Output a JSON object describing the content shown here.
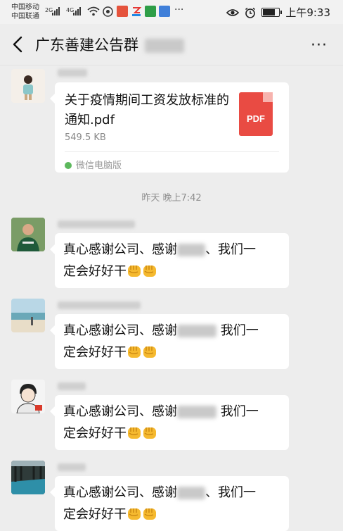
{
  "status_bar": {
    "carrier_1": "中国移动",
    "carrier_2": "中国联通",
    "net_1": "2G",
    "net_2": "4G",
    "dots": "···",
    "time": "上午9:33"
  },
  "nav": {
    "title": "广东善建公告群"
  },
  "file_message": {
    "file_name": "关于疫情期间工资发放标准的通知.pdf",
    "file_size": "549.5 KB",
    "icon_label": "PDF",
    "source": "微信电脑版"
  },
  "time_separator": "昨天 晚上7:42",
  "messages": [
    {
      "line1": "真心感谢公司、感谢",
      "line1_end": "、我们一",
      "line2": "定会好好干"
    },
    {
      "line1": "真心感谢公司、感谢",
      "line1_end": " 我们一",
      "line2": "定会好好干"
    },
    {
      "line1": "真心感谢公司、感谢",
      "line1_end": " 我们一",
      "line2": "定会好好干"
    },
    {
      "line1": "真心感谢公司、感谢",
      "line1_end": "、我们一",
      "line2": "定会好好干"
    }
  ],
  "colors": {
    "background": "#ededed",
    "bubble": "#ffffff",
    "pdf_red": "#e94b43"
  },
  "icons": [
    "back-chevron-icon",
    "more-icon",
    "pdf-file-icon",
    "fist-emoji-icon",
    "wifi-icon",
    "battery-icon",
    "alarm-icon",
    "eye-icon"
  ]
}
